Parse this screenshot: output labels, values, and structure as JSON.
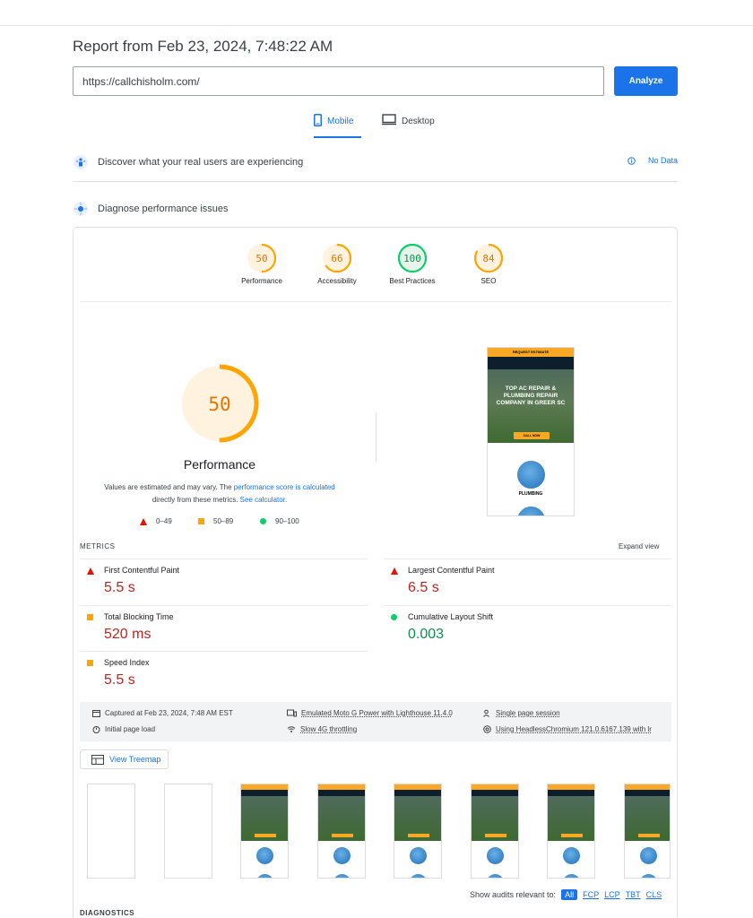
{
  "report": {
    "title": "Report from Feb 23, 2024, 7:48:22 AM"
  },
  "search": {
    "url": "https://callchisholm.com/",
    "analyze_label": "Analyze"
  },
  "tabs": {
    "mobile": "Mobile",
    "desktop": "Desktop"
  },
  "sections": {
    "discover": "Discover what your real users are experiencing",
    "no_data": "No Data",
    "diagnose": "Diagnose performance issues"
  },
  "categories": [
    {
      "label": "Performance",
      "score": "50",
      "color": "#ffa400",
      "fraction": 0.5
    },
    {
      "label": "Accessibility",
      "score": "66",
      "color": "#ffa400",
      "fraction": 0.66
    },
    {
      "label": "Best Practices",
      "score": "100",
      "color": "#0cce6b",
      "fraction": 1.0
    },
    {
      "label": "SEO",
      "score": "84",
      "color": "#ffa400",
      "fraction": 0.84
    }
  ],
  "main_gauge": {
    "score": "50",
    "label": "Performance",
    "fraction": 0.5,
    "color": "#ffa400"
  },
  "note": {
    "before": "Values are estimated and may vary. The ",
    "link1": "performance score is calculated",
    "middle": " directly from these metrics. ",
    "link2": "See calculator."
  },
  "legend": {
    "poor": "0–49",
    "avg": "50–89",
    "good": "90–100"
  },
  "preview": {
    "top_bar": "REQUEST ESTIMATE",
    "headline": "TOP AC REPAIR & PLUMBING REPAIR COMPANY IN GREER SC",
    "cta": "CALL NOW",
    "service": "PLUMBING"
  },
  "metrics": {
    "heading": "METRICS",
    "expand": "Expand view",
    "items": [
      {
        "name": "First Contentful Paint",
        "value": "5.5 s"
      },
      {
        "name": "Largest Contentful Paint",
        "value": "6.5 s"
      },
      {
        "name": "Total Blocking Time",
        "value": "520 ms"
      },
      {
        "name": "Cumulative Layout Shift",
        "value": "0.003"
      },
      {
        "name": "Speed Index",
        "value": "5.5 s"
      }
    ]
  },
  "environment": {
    "captured": "Captured at Feb 23, 2024, 7:48 AM EST",
    "load": "Initial page load",
    "device": "Emulated Moto G Power with Lighthouse 11.4.0",
    "throttle": "Slow 4G throttling",
    "session": "Single page session",
    "browser": "Using HeadlessChromium 121.0.6167.139 with lr"
  },
  "treemap": {
    "label": "View Treemap"
  },
  "audits": {
    "label": "Show audits relevant to:",
    "filters": [
      "All",
      "FCP",
      "LCP",
      "TBT",
      "CLS"
    ]
  },
  "diagnostics": {
    "heading": "DIAGNOSTICS"
  },
  "colors": {
    "accent": "#1a73e8",
    "fail": "#c5221f",
    "average": "#ffa400",
    "pass": "#0cce6b"
  }
}
